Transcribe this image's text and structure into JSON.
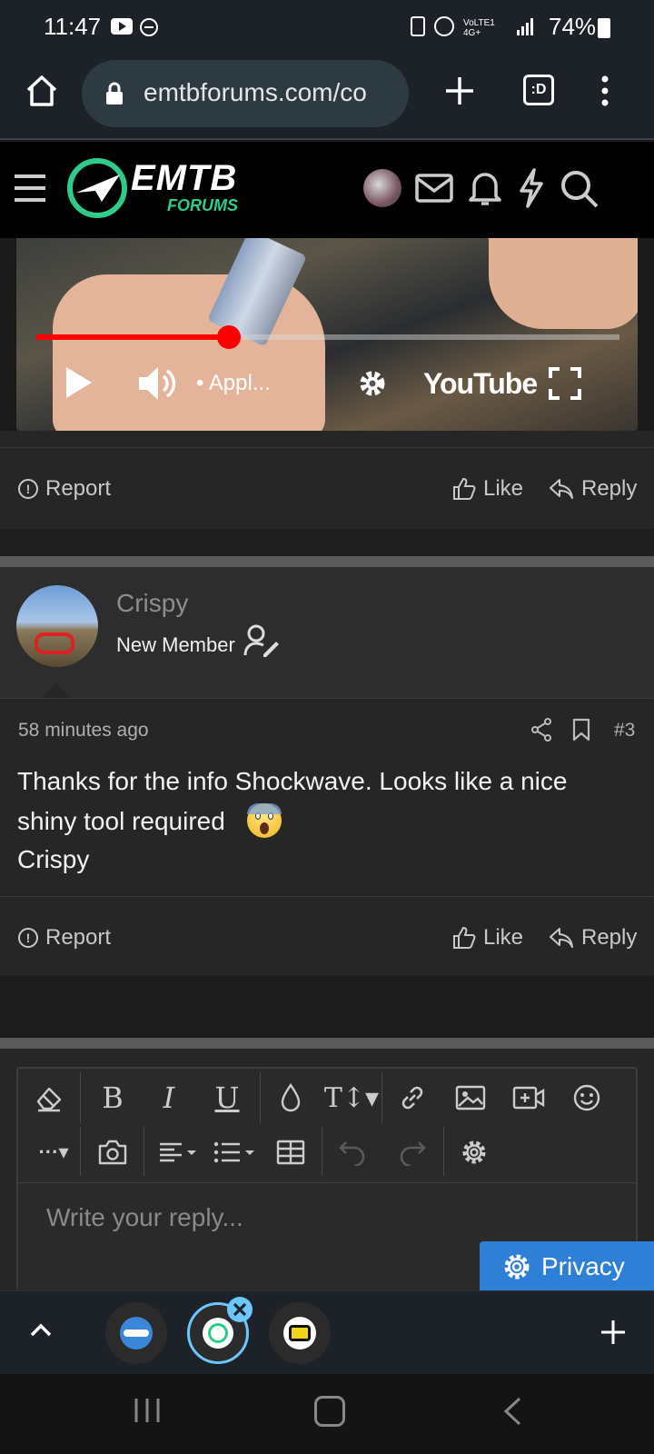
{
  "status_bar": {
    "time": "11:47",
    "network": "VoLTE1 4G+",
    "battery": "74%"
  },
  "browser": {
    "url": "emtbforums.com/co",
    "tab_count": ":D"
  },
  "site": {
    "logo_text": "EMTB",
    "logo_sub": "FORUMS"
  },
  "video": {
    "channel_text": "• Appl...",
    "youtube_label": "YouTube",
    "progress": 0.33
  },
  "post_actions_1": {
    "report": "Report",
    "like": "Like",
    "reply": "Reply"
  },
  "post": {
    "username": "Crispy",
    "user_title": "New Member",
    "time": "58 minutes ago",
    "number": "#3",
    "body_line1": "Thanks for the info Shockwave. Looks like a nice",
    "body_line2": "shiny tool required",
    "emoji": "😱",
    "signature": "Crispy"
  },
  "post_actions_2": {
    "report": "Report",
    "like": "Like",
    "reply": "Reply"
  },
  "editor": {
    "placeholder": "Write your reply..."
  },
  "privacy_button": "Privacy",
  "colors": {
    "accent_blue": "#2e7fd6",
    "brand_green": "#2ecc8a",
    "video_red": "#ff0000"
  }
}
